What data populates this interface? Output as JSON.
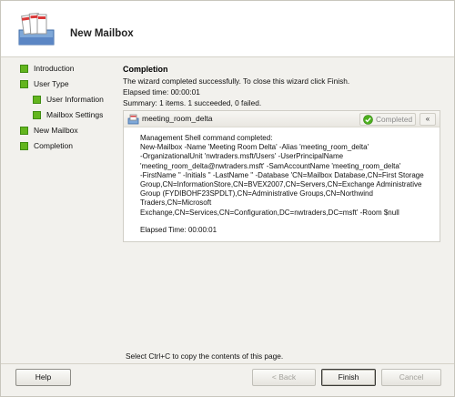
{
  "wizard": {
    "title": "New Mailbox"
  },
  "nav": {
    "items": [
      {
        "label": "Introduction"
      },
      {
        "label": "User Type"
      },
      {
        "label": "User Information"
      },
      {
        "label": "Mailbox Settings"
      },
      {
        "label": "New Mailbox"
      },
      {
        "label": "Completion"
      }
    ]
  },
  "completion": {
    "heading": "Completion",
    "message": "The wizard completed successfully. To close this wizard click Finish.",
    "elapsed": "Elapsed time: 00:00:01",
    "summary": "Summary: 1 items. 1 succeeded, 0 failed."
  },
  "result": {
    "name": "meeting_room_delta",
    "status": "Completed",
    "collapse_glyph": "«",
    "lines": [
      "Management Shell command completed:",
      "New-Mailbox -Name 'Meeting Room Delta' -Alias 'meeting_room_delta'",
      "-OrganizationalUnit 'nwtraders.msft/Users' -UserPrincipalName",
      "'meeting_room_delta@nwtraders.msft' -SamAccountName 'meeting_room_delta'",
      "-FirstName '' -Initials '' -LastName '' -Database 'CN=Mailbox Database,CN=First Storage",
      "Group,CN=InformationStore,CN=BVEX2007,CN=Servers,CN=Exchange Administrative",
      "Group (FYDIBOHF23SPDLT),CN=Administrative Groups,CN=Northwind",
      "Traders,CN=Microsoft",
      "Exchange,CN=Services,CN=Configuration,DC=nwtraders,DC=msft' -Room $null"
    ],
    "elapsed": "Elapsed Time: 00:00:01"
  },
  "hint": "Select Ctrl+C to copy the contents of this page.",
  "buttons": {
    "help": {
      "label": "Help"
    },
    "back": {
      "label": "< Back"
    },
    "finish": {
      "label": "Finish"
    },
    "cancel": {
      "label": "Cancel"
    }
  },
  "colors": {
    "nav_bullet": "#63b51e",
    "status_check": "#4caf1e"
  }
}
